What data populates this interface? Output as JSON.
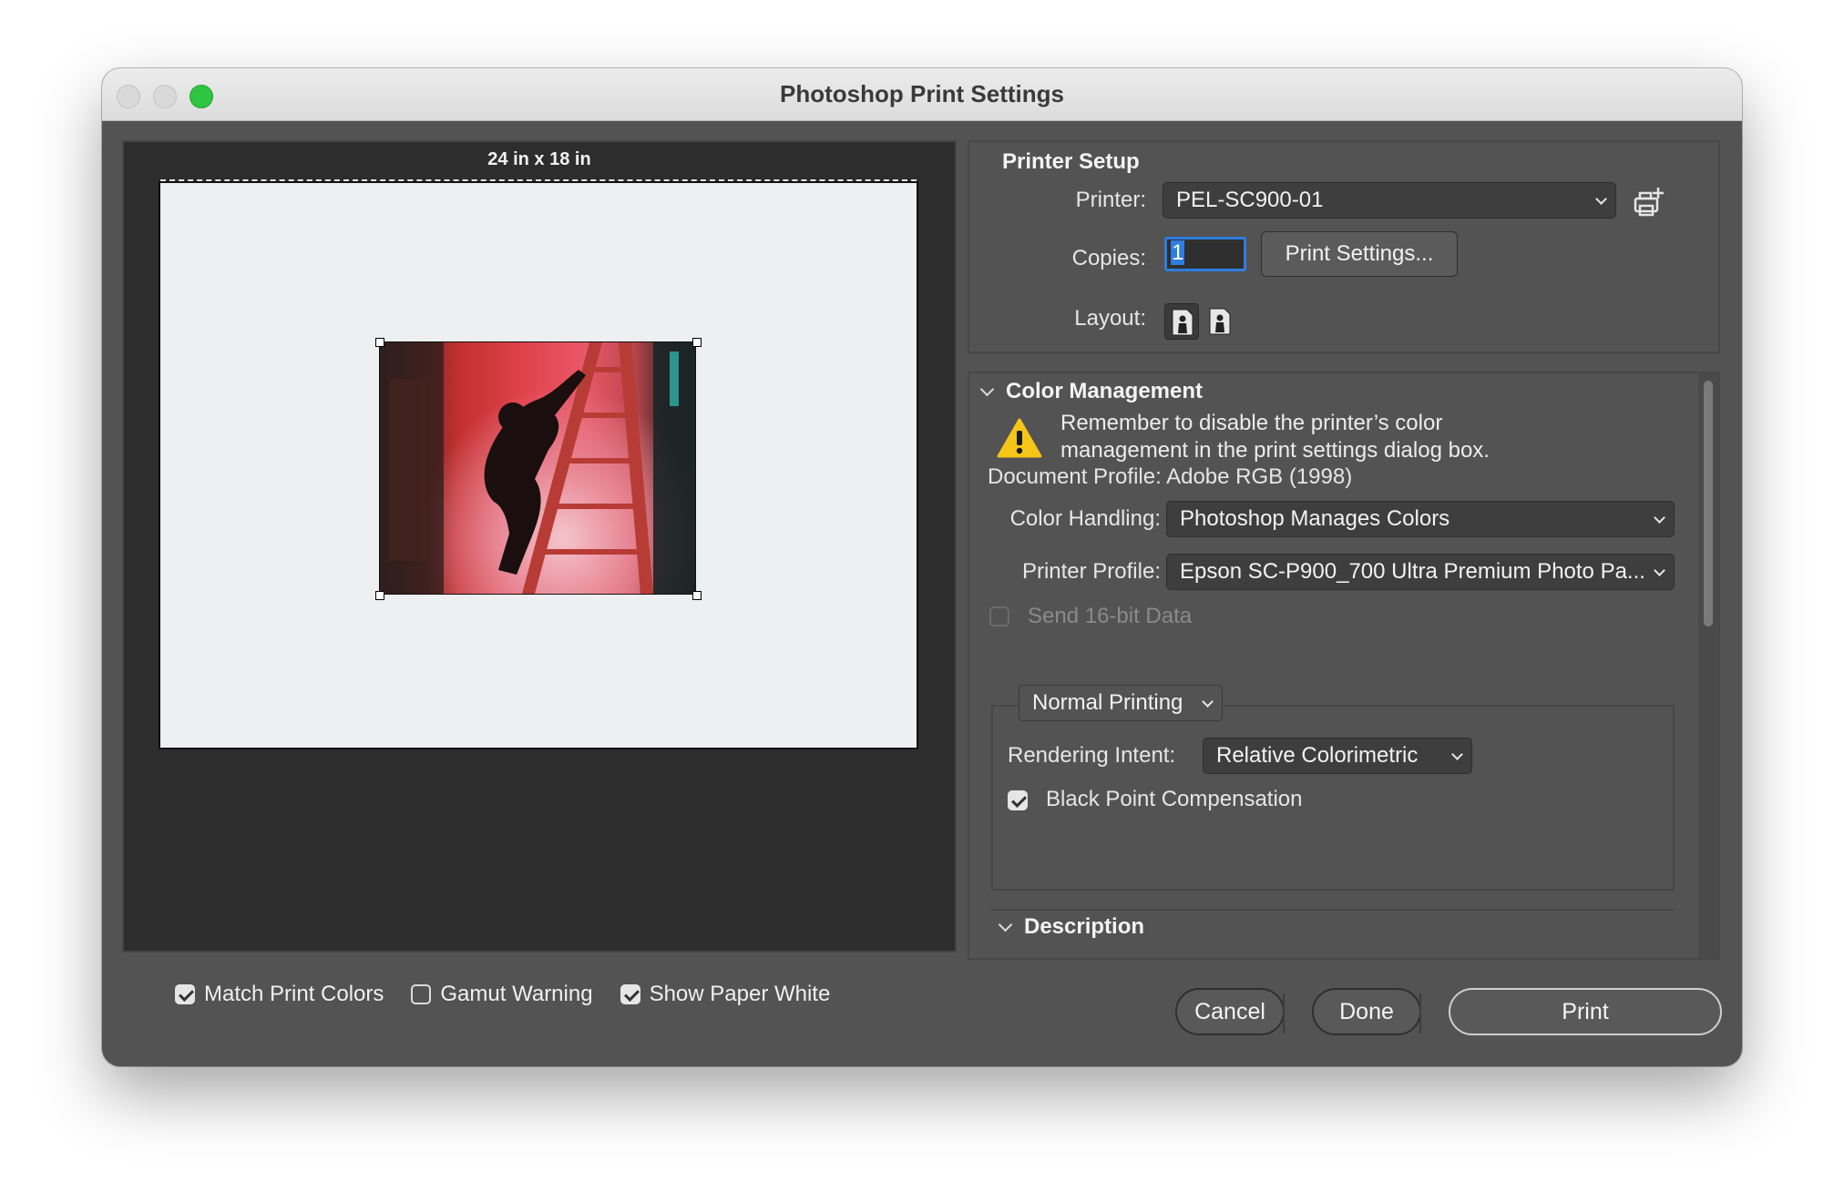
{
  "window": {
    "title": "Photoshop Print Settings"
  },
  "preview": {
    "paper_size": "24 in x 18 in"
  },
  "preview_options": [
    {
      "label": "Match Print Colors",
      "checked": true
    },
    {
      "label": "Gamut Warning",
      "checked": false
    },
    {
      "label": "Show Paper White",
      "checked": true
    }
  ],
  "printer_setup": {
    "title": "Printer Setup",
    "printer_label": "Printer:",
    "printer_value": "PEL-SC900-01",
    "copies_label": "Copies:",
    "copies_value": "1",
    "print_settings_button": "Print Settings...",
    "layout_label": "Layout:"
  },
  "color_management": {
    "title": "Color Management",
    "warning": "Remember to disable the printer’s color management in the print settings dialog box.",
    "document_profile": "Document Profile: Adobe RGB (1998)",
    "color_handling_label": "Color Handling:",
    "color_handling_value": "Photoshop Manages Colors",
    "printer_profile_label": "Printer Profile:",
    "printer_profile_value": "Epson SC-P900_700 Ultra Premium Photo Pa...",
    "send_16bit_label": "Send 16-bit Data",
    "send_16bit_checked": false,
    "printing_mode": "Normal Printing",
    "rendering_intent_label": "Rendering Intent:",
    "rendering_intent_value": "Relative Colorimetric",
    "black_point_label": "Black Point Compensation",
    "black_point_checked": true
  },
  "description": {
    "title": "Description"
  },
  "footer": {
    "cancel": "Cancel",
    "done": "Done",
    "print": "Print"
  },
  "colors": {
    "window_bg": "#535353",
    "preview_bg": "#2d2d2d",
    "paper": "#eeeff1",
    "accent": "#2e7de0",
    "warning": "#f5c518",
    "maximize": "#2fc441"
  }
}
